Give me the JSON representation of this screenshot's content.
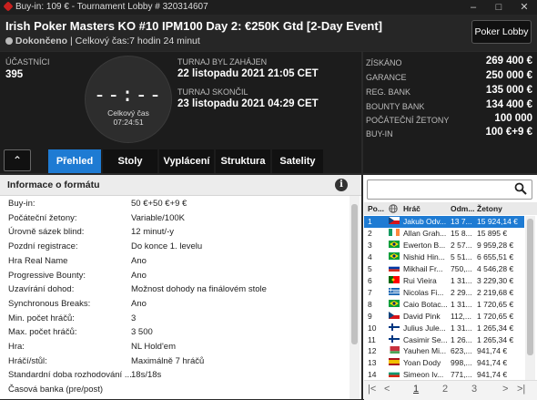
{
  "window": {
    "title": "Buy-in: 109 € - Tournament Lobby # 320314607",
    "minimize": "–",
    "maximize": "□",
    "close": "✕"
  },
  "header": {
    "tournament_name": "Irish Poker Masters KO #10 IPM100 Day 2: €250K Gtd [2-Day Event]",
    "status": "Dokončeno",
    "total_time": "| Celkový čas:7 hodin  24 minut",
    "lobby_button": "Poker Lobby"
  },
  "info": {
    "participants_label": "ÚČASTNÍCI",
    "participants_value": "395",
    "clock_display": "--:--",
    "clock_label": "Celkový čas",
    "clock_value": "07:24:51",
    "started_label": "TURNAJ BYL ZAHÁJEN",
    "started_value": "22 listopadu 2021   21:05 CET",
    "ended_label": "TURNAJ SKONČIL",
    "ended_value": "23 listopadu 2021   04:29 CET"
  },
  "prizes": [
    {
      "label": "ZÍSKÁNO",
      "value": "269 400 €"
    },
    {
      "label": "GARANCE",
      "value": "250 000 €"
    },
    {
      "label": "REG. BANK",
      "value": "135 000 €"
    },
    {
      "label": "BOUNTY BANK",
      "value": "134 400 €"
    },
    {
      "label": "POČÁTEČNÍ ŽETONY",
      "value": "100 000"
    },
    {
      "label": "BUY-IN",
      "value": "100 €+9 €"
    }
  ],
  "tabs": {
    "collapse": "⌃",
    "items": [
      "Přehled",
      "Stoly",
      "Vyplácení",
      "Struktura",
      "Satelity"
    ],
    "active": 0
  },
  "format": {
    "title": "Informace o formátu",
    "info_icon": "i",
    "rows": [
      {
        "key": "Buy-in:",
        "value": "50 €+50 €+9 €"
      },
      {
        "key": "Počáteční žetony:",
        "value": "Variable/100K"
      },
      {
        "key": "Úrovně sázek blind:",
        "value": "12 minut/-y"
      },
      {
        "key": "Pozdní registrace:",
        "value": "Do konce 1. levelu"
      },
      {
        "key": "Hra Real Name",
        "value": "Ano"
      },
      {
        "key": "Progressive Bounty:",
        "value": "Ano"
      },
      {
        "key": "Uzavírání dohod:",
        "value": "Možnost dohody na finálovém stole"
      },
      {
        "key": "Synchronous Breaks:",
        "value": "Ano"
      },
      {
        "key": "Min. počet hráčů:",
        "value": "3"
      },
      {
        "key": "Max. počet hráčů:",
        "value": "3 500"
      },
      {
        "key": "Hra:",
        "value": "NL Hold'em"
      },
      {
        "key": "Hráčí/stůl:",
        "value": "Maximálně 7 hráčů"
      },
      {
        "key": "Standardní doba rozhodování ...",
        "value": "18s/18s"
      },
      {
        "key": "Časová banka (pre/post)",
        "value": ""
      }
    ]
  },
  "players": {
    "search_placeholder": "",
    "columns": [
      "Po...",
      "",
      "Hráč",
      "Odm...",
      "Žetony"
    ],
    "rows": [
      {
        "pos": "1",
        "flag": "cz",
        "name": "Jakub Odv...",
        "prize": "13 7...",
        "chips": "15 924,14 €"
      },
      {
        "pos": "2",
        "flag": "ie",
        "name": "Allan Grah...",
        "prize": "15 8...",
        "chips": "15 895 €"
      },
      {
        "pos": "3",
        "flag": "br",
        "name": "Ewerton B...",
        "prize": "2 57...",
        "chips": "9 959,28 €"
      },
      {
        "pos": "4",
        "flag": "br",
        "name": "Nishid Hin...",
        "prize": "5 51...",
        "chips": "6 655,51 €"
      },
      {
        "pos": "5",
        "flag": "ru",
        "name": "Mikhail Fr...",
        "prize": "750,...",
        "chips": "4 546,28 €"
      },
      {
        "pos": "6",
        "flag": "pt",
        "name": "Rui Vieira",
        "prize": "1 31...",
        "chips": "3 229,30 €"
      },
      {
        "pos": "7",
        "flag": "gr",
        "name": "Nicolas Fi...",
        "prize": "2 29...",
        "chips": "2 219,68 €"
      },
      {
        "pos": "8",
        "flag": "br",
        "name": "Caio Botac...",
        "prize": "1 31...",
        "chips": "1 720,65 €"
      },
      {
        "pos": "9",
        "flag": "cz",
        "name": "David Pink",
        "prize": "112,...",
        "chips": "1 720,65 €"
      },
      {
        "pos": "10",
        "flag": "fi",
        "name": "Julius Jule...",
        "prize": "1 31...",
        "chips": "1 265,34 €"
      },
      {
        "pos": "11",
        "flag": "fi",
        "name": "Casimir Se...",
        "prize": "1 26...",
        "chips": "1 265,34 €"
      },
      {
        "pos": "12",
        "flag": "by",
        "name": "Yauhen Mi...",
        "prize": "623,...",
        "chips": "941,74 €"
      },
      {
        "pos": "13",
        "flag": "es",
        "name": "Yoan Dody",
        "prize": "998,...",
        "chips": "941,74 €"
      },
      {
        "pos": "14",
        "flag": "bg",
        "name": "Simeon Iv...",
        "prize": "771,...",
        "chips": "941,74 €"
      }
    ],
    "selected": 0,
    "pager": {
      "first": "|<",
      "prev": "<",
      "pages": [
        "1",
        "2",
        "3"
      ],
      "current": "1",
      "next": ">",
      "last": ">|"
    }
  },
  "colors": {
    "accent": "#1e7bd3",
    "status_dot": "#bbbbbb",
    "dark_bg": "#1c1c1c"
  }
}
